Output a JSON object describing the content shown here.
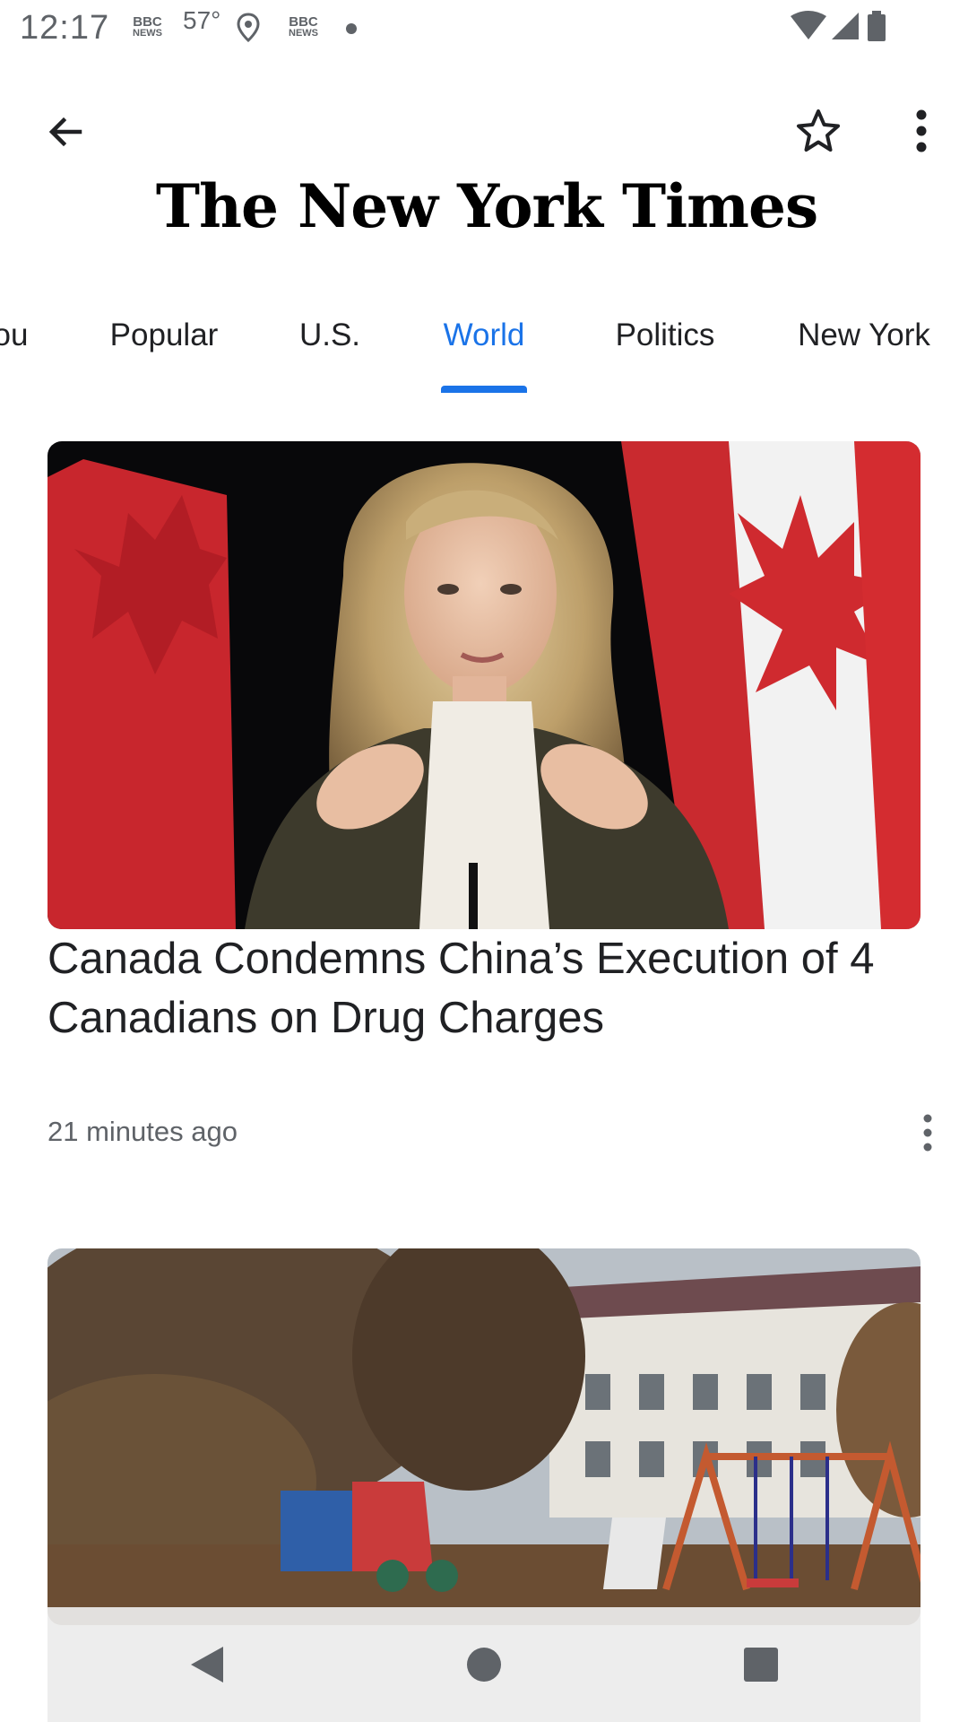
{
  "status_bar": {
    "time": "12:17",
    "notification_icons": [
      "bbc-news-icon",
      "temperature-icon",
      "location-pin-icon",
      "bbc-news-icon",
      "dot-icon"
    ],
    "news_badge_line1": "BBC",
    "news_badge_line2": "NEWS",
    "temperature": "57°",
    "system_icons": [
      "wifi-icon",
      "signal-icon",
      "battery-icon"
    ]
  },
  "toolbar": {
    "back_icon": "arrow-left-icon",
    "star_icon": "star-outline-icon",
    "more_icon": "more-vertical-icon",
    "masthead": "The New York Times"
  },
  "tabs": {
    "items": [
      {
        "label": "ou"
      },
      {
        "label": "Popular"
      },
      {
        "label": "U.S."
      },
      {
        "label": "World"
      },
      {
        "label": "Politics"
      },
      {
        "label": "New York"
      }
    ],
    "selected": "World"
  },
  "articles": [
    {
      "headline": "Canada Condemns China’s Execution of 4 Canadians on Drug Charges",
      "time": "21 minutes ago",
      "image": "Woman speaking at podium in front of Canadian flags"
    },
    {
      "headline": "",
      "time": "",
      "image": "Playground with swings in front of a building among autumn trees"
    }
  ],
  "navigation_bar": {
    "icons": [
      "back-triangle-icon",
      "home-circle-icon",
      "recents-square-icon"
    ]
  },
  "colors": {
    "accent": "#1a73e8",
    "text_primary": "#202124",
    "text_secondary": "#5f6368",
    "flag_red": "#d52b1e"
  }
}
